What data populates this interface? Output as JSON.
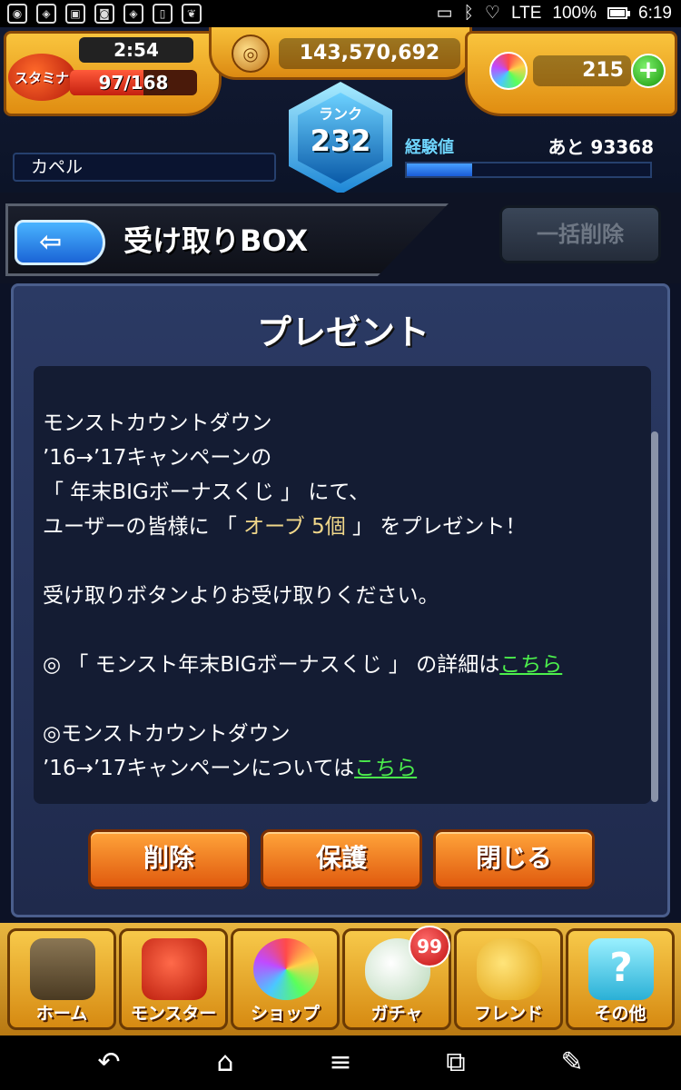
{
  "status_bar": {
    "battery": "100%",
    "time": "6:19",
    "signal": "LTE"
  },
  "header": {
    "stamina_label": "スタミナ",
    "stamina_timer": "2:54",
    "stamina_count": "97/168",
    "stamina_fraction": 0.577,
    "gold": "143,570,692",
    "orbs": "215",
    "rank_label": "ランク",
    "rank": "232",
    "player_name": "カペル",
    "exp_label": "経験値",
    "exp_remaining": "あと 93368",
    "exp_fraction": 0.27
  },
  "title_bar": {
    "title": "受け取りBOX",
    "bulk_delete": "一括削除"
  },
  "dialog": {
    "title": "プレゼント",
    "lines": {
      "l1": "モンストカウントダウン",
      "l2": "’16→’17キャンペーンの",
      "l3": "「 年末BIGボーナスくじ 」 にて、",
      "l4a": "ユーザーの皆様に 「 ",
      "l4b": "オーブ 5個",
      "l4c": " 」 をプレゼント！",
      "l5": "受け取りボタンよりお受け取りください。",
      "l6a": "◎ 「 モンスト年末BIGボーナスくじ 」 の詳細は",
      "l6_link": "こちら",
      "l7": "◎モンストカウントダウン",
      "l8a": "’16→’17キャンペーンについては",
      "l8_link": "こちら"
    },
    "buttons": {
      "delete": "削除",
      "protect": "保護",
      "close": "閉じる"
    }
  },
  "bottom_nav": {
    "home": "ホーム",
    "monster": "モンスター",
    "shop": "ショップ",
    "gacha": "ガチャ",
    "gacha_badge": "99",
    "friend": "フレンド",
    "other": "その他"
  },
  "colors": {
    "accent_orange": "#e05a0e",
    "link_green": "#4cf04c",
    "panel_navy": "#1f2a4c"
  }
}
